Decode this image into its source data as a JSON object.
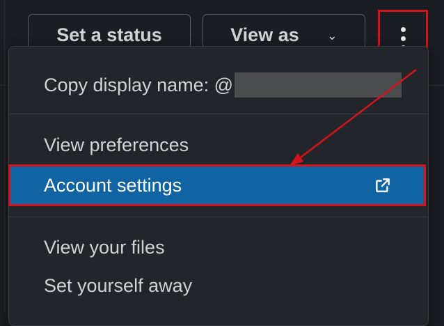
{
  "header": {
    "set_status_label": "Set a status",
    "view_as_label": "View as",
    "view_as_chevron": "⌄"
  },
  "menu": {
    "copy_display_name_label": "Copy display name: @",
    "view_preferences_label": "View preferences",
    "account_settings_label": "Account settings",
    "view_files_label": "View your files",
    "set_away_label": "Set yourself away"
  },
  "icons": {
    "more": "vertical-ellipsis-icon",
    "external_link": "external-link-icon"
  },
  "colors": {
    "highlight": "#1164a3",
    "annotation": "#d4141b",
    "background": "#1a1d21",
    "menu_background": "#222529"
  }
}
